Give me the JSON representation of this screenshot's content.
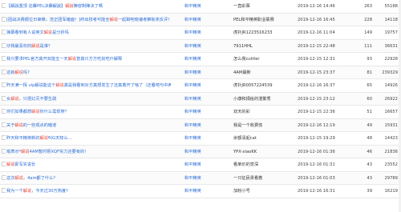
{
  "rows": [
    {
      "pre": "【解說置頂 迄賽PEL決賽解說】",
      "hl": "解說",
      "post": "陣容對陣決了嗎",
      "board": "和平精英",
      "author": "一直彩票",
      "date": "2019-12-16 14:46",
      "replies": "263",
      "views": "55188"
    },
    {
      "pre": "[团战决赛顺位日审推，范正团军暗面！]终出技考可能全",
      "hl": "解说",
      "post": "一起聊吧晓诸考察板奖反评！",
      "board": "和平精英",
      "author": "PEL和平精英职业联赛",
      "date": "2019-12-16 16:45",
      "replies": "228",
      "views": "14118"
    },
    {
      "pre": "弹幕看到有人说英文",
      "hl": "解说",
      "post": "是分析吗",
      "board": "和平精英",
      "author": "虎扑JR1223516233",
      "date": "2019-12-16 11:04",
      "replies": "149",
      "views": "19757"
    },
    {
      "pre": "仔我最喜欢的",
      "hl": "解说",
      "post": "是谁？",
      "board": "和平精英",
      "author": "7911HHL",
      "date": "2019-12-15 22:48",
      "replies": "111",
      "views": "36631"
    },
    {
      "pre": "我只要求PEL官方真开双能五一天",
      "hl": "解说",
      "post": "意真只方方吃剑吃什解释",
      "board": "和平精英",
      "author": "怎么我cuttler",
      "date": "2019-12-15 12:31",
      "replies": "93",
      "views": "22928"
    },
    {
      "pre": "这就",
      "hl": "解说",
      "post": "吗?",
      "board": "和平精英",
      "author": "4AM最新",
      "date": "2019-12-15 23:37",
      "replies": "81",
      "views": "239329"
    },
    {
      "pre": "昨天满一挥 vip解说能这个",
      "hl": "解说",
      "post": "真是我看到对方真想发生了还真着开了啥了（还看吧与中两有彩面",
      "board": "和平精英",
      "author": "虎扑JR0057224539",
      "date": "2019-12-16 16:37",
      "replies": "65",
      "views": "14926"
    },
    {
      "pre": "女",
      "hl": "解说",
      "post": "，只把幻灭不要生疏",
      "board": "和平精英",
      "author": "小康和捐给的湛繁秀",
      "date": "2019-12-15 23:12",
      "replies": "60",
      "views": "26922"
    },
    {
      "pre": "你们如果都想",
      "hl": "解说",
      "post": "你什么需现穿？",
      "board": "和平精英",
      "author": "双天的彩",
      "date": "2019-12-15 22:36",
      "replies": "51",
      "views": "16657"
    },
    {
      "pre": "关于",
      "hl": "解说",
      "post": "的一些观点的暗道",
      "board": "和平精英",
      "author": "我是一个收费债",
      "date": "2019-12-16 12:19",
      "replies": "49",
      "views": "15931"
    },
    {
      "pre": "昨天和平精英新的",
      "hl": "解说",
      "post": "叫G天知么…",
      "board": "和平精英",
      "author": "余额清起cat",
      "date": "2019-12-15 19:29",
      "replies": "48",
      "views": "14423"
    },
    {
      "pre": "喻表示*",
      "hl": "解说",
      "post": "4AM暂时把XQF实力还要有的!",
      "board": "和平精英",
      "author": "YPX-xiaoKK",
      "date": "2019-12-16 01:36",
      "replies": "46",
      "views": "21836"
    },
    {
      "pre": "",
      "hl": "解说",
      "post": "即写实说长",
      "board": "和平精英",
      "author": "看单价的觉深",
      "date": "2019-12-16 01:31",
      "replies": "43",
      "views": "23552"
    },
    {
      "pre": "这次",
      "hl": "解说",
      "post": "，4am都了什么?",
      "board": "和平精英",
      "author": "一只征民贵看着",
      "date": "2019-12-16 01:03",
      "replies": "43",
      "views": "29789"
    },
    {
      "pre": "我为一个",
      "hl": "解说",
      "post": "，今天过30万热度?",
      "board": "和平精英",
      "author": "加粉小号",
      "date": "2019-12-16 16:31",
      "replies": "39",
      "views": "16219"
    }
  ]
}
